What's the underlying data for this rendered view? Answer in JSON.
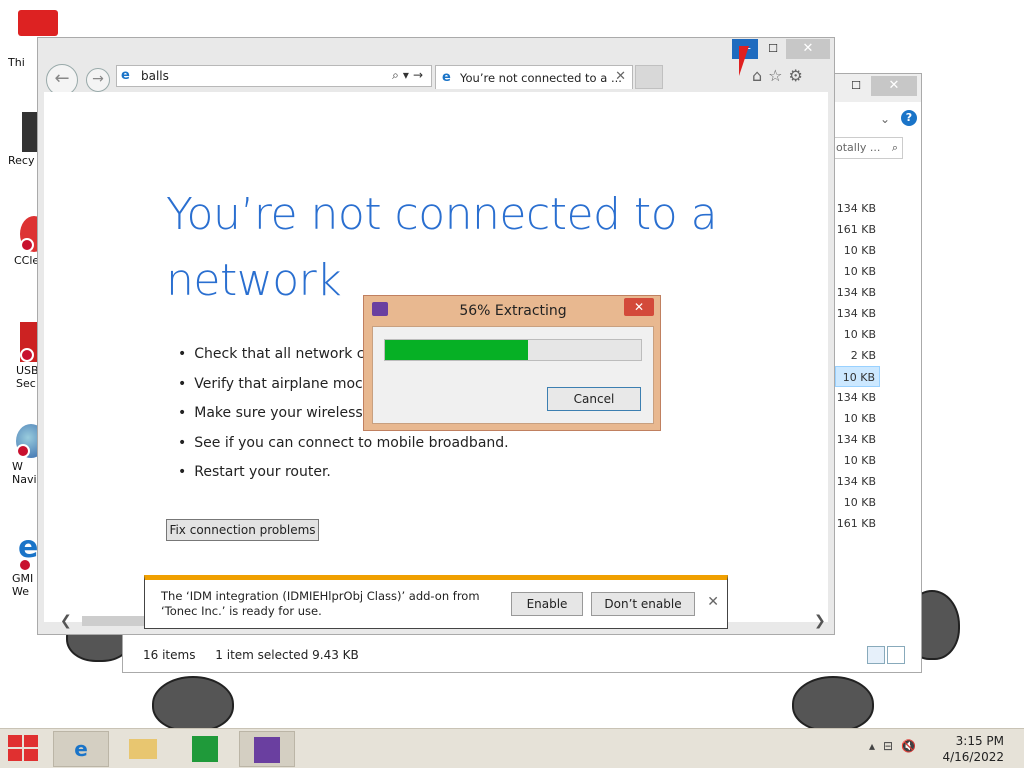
{
  "desktop": {
    "icons": [
      {
        "label": "Thi"
      },
      {
        "label": "Recy"
      },
      {
        "label": "CCle"
      },
      {
        "label": "USB Sec"
      },
      {
        "label": "W Navi"
      },
      {
        "label": "GMI We"
      }
    ]
  },
  "explorer": {
    "search_placeholder": "otally ...",
    "sizes": [
      "134 KB",
      "161 KB",
      "10 KB",
      "10 KB",
      "134 KB",
      "134 KB",
      "10 KB",
      "2 KB",
      "10 KB",
      "134 KB",
      "10 KB",
      "134 KB",
      "10 KB",
      "134 KB",
      "10 KB",
      "161 KB"
    ],
    "selected_index": 8,
    "status_items": "16 items",
    "status_selected": "1 item selected  9.43 KB"
  },
  "ie": {
    "address": "balls",
    "tab_title": "You’re not connected to a ...",
    "heading": "You’re not connected to a network",
    "tips": [
      "Check that all network c",
      "Verify that airplane moc",
      "Make sure your wireless",
      "See if you can connect to mobile broadband.",
      "Restart your router."
    ],
    "fix_button": "Fix connection problems"
  },
  "notification": {
    "message": "The ‘IDM integration (IDMIEHlprObj Class)’ add-on from ‘Tonec Inc.’ is ready for use.",
    "enable": "Enable",
    "dont_enable": "Don’t enable"
  },
  "dialog": {
    "title": "56% Extracting",
    "progress": 0.56,
    "cancel": "Cancel"
  },
  "taskbar": {
    "time": "3:15 PM",
    "date": "4/16/2022"
  }
}
